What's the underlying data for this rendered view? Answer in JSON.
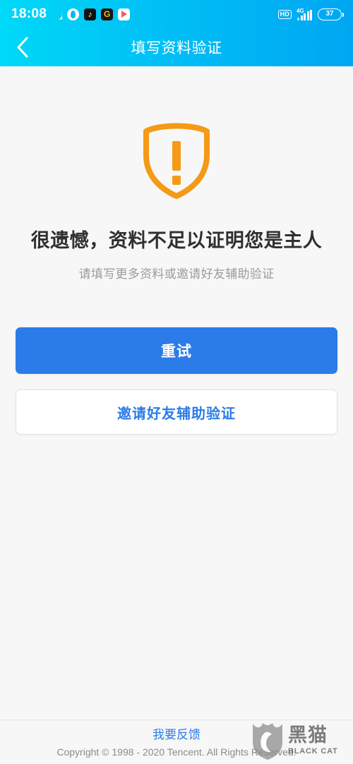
{
  "status_bar": {
    "time": "18:08",
    "icons": [
      "moon-icon",
      "water-drop-app-icon",
      "tiktok-app-icon",
      "g-app-icon",
      "play-store-app-icon"
    ],
    "hd_label": "HD",
    "network_label": "4G",
    "battery_level": "37"
  },
  "nav": {
    "back_icon": "chevron-left-icon",
    "title": "填写资料验证"
  },
  "content": {
    "illustration": "shield-exclamation-icon",
    "headline": "很遗憾，资料不足以证明您是主人",
    "subline": "请填写更多资料或邀请好友辅助验证",
    "primary_button": "重试",
    "secondary_button": "邀请好友辅助验证"
  },
  "footer": {
    "feedback_link": "我要反馈",
    "copyright": "Copyright © 1998 - 2020 Tencent. All Rights Reserved."
  },
  "watermark": {
    "cn": "黑猫",
    "en": "BLACK CAT"
  },
  "colors": {
    "header_gradient_start": "#00d9f7",
    "header_gradient_end": "#00a6f2",
    "accent_blue": "#2b7ce8",
    "warning_orange": "#f59a16",
    "page_background": "#f7f7f7",
    "headline_text": "#2f2f2f",
    "subline_text": "#9b9b9b"
  }
}
